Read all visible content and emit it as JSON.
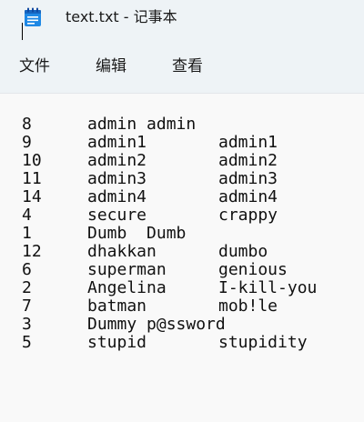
{
  "window": {
    "title": "text.txt - 记事本",
    "app_icon": "notepad-icon"
  },
  "menu": {
    "file": "文件",
    "edit": "编辑",
    "view": "查看"
  },
  "editor": {
    "lines": [
      {
        "c1": "8",
        "c2": "admin admin",
        "c3": ""
      },
      {
        "c1": "9",
        "c2": "admin1",
        "c3": "admin1"
      },
      {
        "c1": "10",
        "c2": "admin2",
        "c3": "admin2"
      },
      {
        "c1": "11",
        "c2": "admin3",
        "c3": "admin3"
      },
      {
        "c1": "14",
        "c2": "admin4",
        "c3": "admin4"
      },
      {
        "c1": "4",
        "c2": "secure",
        "c3": "crappy"
      },
      {
        "c1": "1",
        "c2": "Dumb  Dumb",
        "c3": ""
      },
      {
        "c1": "12",
        "c2": "dhakkan",
        "c3": "dumbo"
      },
      {
        "c1": "6",
        "c2": "superman",
        "c3": "genious"
      },
      {
        "c1": "2",
        "c2": "Angelina",
        "c3": "I-kill-you"
      },
      {
        "c1": "7",
        "c2": "batman",
        "c3": "mob!le"
      },
      {
        "c1": "3",
        "c2": "Dummy p@ssword",
        "c3": ""
      },
      {
        "c1": "5",
        "c2": "stupid",
        "c3": "stupidity"
      }
    ]
  }
}
